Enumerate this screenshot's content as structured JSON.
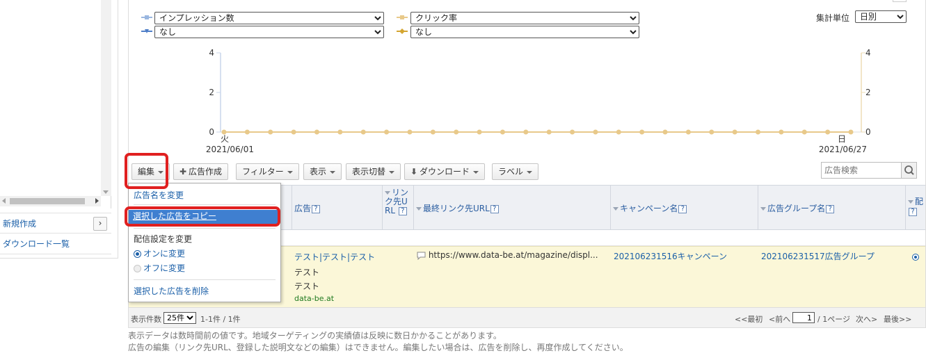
{
  "sidebar": {
    "items": [
      {
        "label": "新規作成"
      },
      {
        "label": "ダウンロード一覧"
      }
    ],
    "new_arrow": "›"
  },
  "chart_controls": {
    "metric1": {
      "selected": "インプレッション数",
      "color": "#9ab7e0"
    },
    "metric1b": {
      "selected": "なし",
      "color": "#4f7fc8"
    },
    "metric2": {
      "selected": "クリック率",
      "color": "#e8c98a"
    },
    "metric2b": {
      "selected": "なし",
      "color": "#d4a531"
    },
    "agg_label": "集計単位",
    "agg_selected": "日別"
  },
  "chart_data": {
    "type": "line",
    "x_start": "2021/06/01",
    "x_start_day": "火",
    "x_end": "2021/06/27",
    "x_end_day": "日",
    "y_left_ticks": [
      "4",
      "2",
      "0"
    ],
    "y_right_ticks": [
      "4",
      "2",
      "0"
    ],
    "ylim": [
      0,
      4
    ],
    "series": [
      {
        "values": [
          0,
          0,
          0,
          0,
          0,
          0,
          0,
          0,
          0,
          0,
          0,
          0,
          0,
          0,
          0,
          0,
          0,
          0,
          0,
          0,
          0,
          0,
          0,
          0,
          0,
          0,
          0,
          0
        ],
        "color": "#e8c98a"
      }
    ]
  },
  "toolbar": {
    "edit": "編集",
    "create": "広告作成",
    "filter": "フィルター",
    "display": "表示",
    "switch": "表示切替",
    "download": "ダウンロード",
    "label": "ラベル",
    "search_placeholder": "広告検索"
  },
  "menu": {
    "rename": "広告名を変更",
    "copy": "選択した広告をコピー",
    "delivery": "配信設定を変更",
    "on": "オンに変更",
    "off": "オフに変更",
    "delete": "選択した広告を削除"
  },
  "table": {
    "headers": {
      "ad": "広告",
      "link": "リンク先URL",
      "final_url": "最終リンク先URL",
      "campaign": "キャンペーン名",
      "adgroup": "広告グループ名",
      "delivery": "配"
    },
    "row": {
      "title": "テスト|テスト|テスト",
      "desc1": "テスト",
      "desc2": "テスト",
      "display_url": "data-be.at",
      "final_url": "https://www.data-be.at/magazine/displ...",
      "campaign": "202106231516キャンペーン",
      "adgroup": "202106231517広告グループ"
    }
  },
  "footer": {
    "count_label": "表示件数",
    "count_selected": "25件",
    "range": "1-1件 / 1件",
    "first": "<<最初",
    "prev": "<前へ",
    "page": "1",
    "pages": "/ 1ページ",
    "next": "次へ>",
    "last": "最後>>",
    "note1": "表示データは数時間前の値です。地域ターゲティングの実績値は反映に数日かかることがあります。",
    "note2": "広告の編集（リンク先URL、登録した説明文などの編集）はできません。編集したい場合は、広告を削除し、再度作成してください。"
  }
}
